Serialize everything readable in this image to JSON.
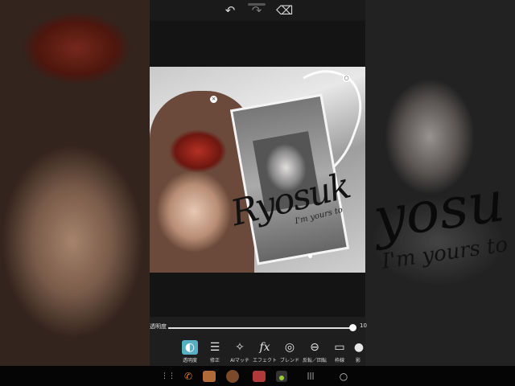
{
  "editor": {
    "topbar": {
      "undo_icon": "↶",
      "redo_icon": "↷",
      "eraser_icon": "⌫"
    },
    "artwork": {
      "script_text": "Ryosuk",
      "small_text": "I'm yours to",
      "close_handle": "×",
      "top_handle": "○"
    },
    "opacity_slider": {
      "label": "透明度",
      "value": "10",
      "level_percent": 100
    },
    "tools": [
      {
        "label": "透明度",
        "icon": "◐",
        "active": true
      },
      {
        "label": "修正",
        "icon": "☰",
        "active": false
      },
      {
        "label": "AIマッチ",
        "icon": "✧",
        "active": false
      },
      {
        "label": "エフェクト",
        "icon": "fx",
        "active": false
      },
      {
        "label": "ブレンド",
        "icon": "◎",
        "active": false
      },
      {
        "label": "反転／回転",
        "icon": "⊖",
        "active": false
      },
      {
        "label": "枠線",
        "icon": "▭",
        "active": false
      },
      {
        "label": "影",
        "icon": "●",
        "active": false
      }
    ]
  },
  "side_background": {
    "big_text": "yosu",
    "small_text": "I'm yours to"
  },
  "system_nav": {
    "menu_icon": "⋮⋮",
    "phone_icon": "✆",
    "recents_icon": "|||",
    "home_icon": "○"
  },
  "colors": {
    "accent": "#55b0c3",
    "app_bg": "#1c1c1c"
  }
}
